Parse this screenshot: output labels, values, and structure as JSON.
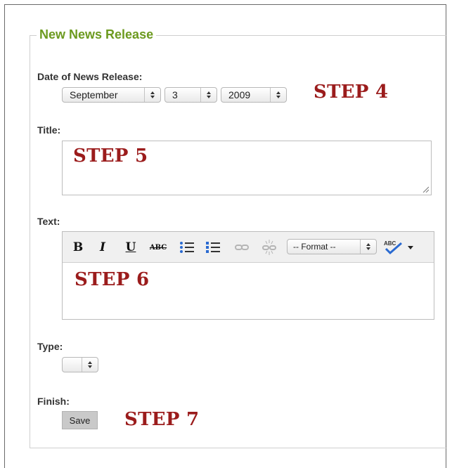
{
  "form": {
    "legend": "New News Release",
    "date": {
      "label": "Date of News Release:",
      "month": "September",
      "day": "3",
      "year": "2009"
    },
    "title_field": {
      "label": "Title:",
      "value": ""
    },
    "text_field": {
      "label": "Text:",
      "toolbar": {
        "bold": "B",
        "italic": "I",
        "underline": "U",
        "strikethrough": "ABC",
        "format_select": "-- Format --"
      }
    },
    "type_field": {
      "label": "Type:",
      "value": ""
    },
    "finish": {
      "label": "Finish:",
      "save_label": "Save"
    }
  },
  "annotations": {
    "step4": "STEP 4",
    "step5": "STEP 5",
    "step6": "STEP 6",
    "step7": "STEP 7"
  },
  "colors": {
    "legend": "#6c9a1f",
    "step_text": "#9b1c1c"
  },
  "icons": [
    "stepper-arrows-icon",
    "resize-grip-icon",
    "bullet-list-icon",
    "numbered-list-icon",
    "link-icon",
    "unlink-icon",
    "spellcheck-icon",
    "dropdown-caret-icon"
  ]
}
